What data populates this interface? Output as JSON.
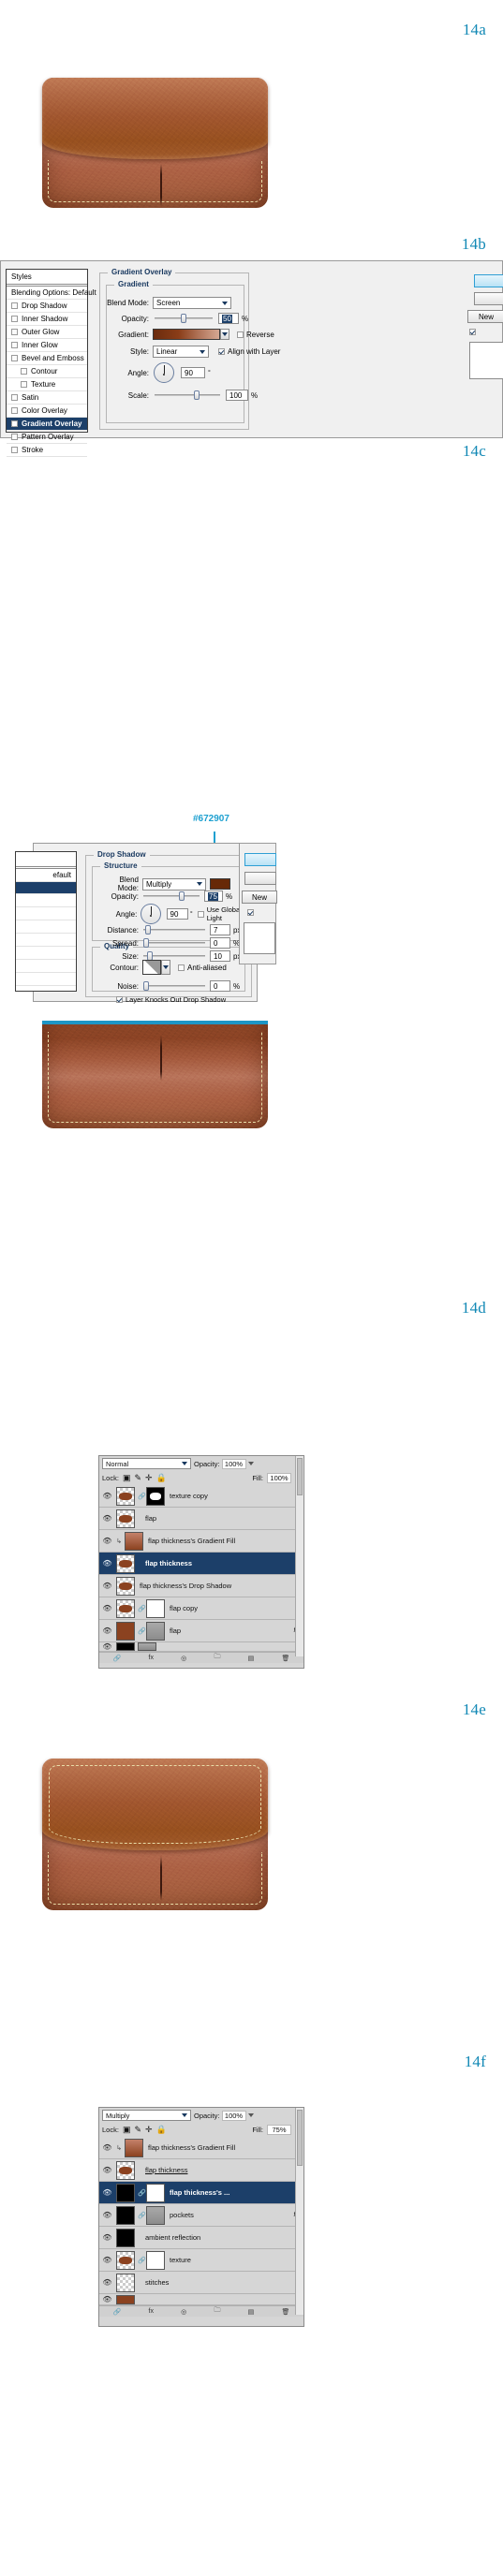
{
  "figures": [
    {
      "id": "14a",
      "label": "14a"
    },
    {
      "id": "14b",
      "label": "14b"
    },
    {
      "id": "14c",
      "label": "14c"
    },
    {
      "id": "14d",
      "label": "14d"
    },
    {
      "id": "14e",
      "label": "14e"
    },
    {
      "id": "14f",
      "label": "14f"
    }
  ],
  "colors": {
    "figure_label": "#1188b5",
    "callout": "#1da0d0",
    "drop_shadow_color": "#672907",
    "selection": "#1c3f69"
  },
  "gradient_overlay_dialog": {
    "styles_panel": {
      "header": "Styles",
      "blending_options": "Blending Options: Default",
      "items": [
        {
          "label": "Drop Shadow",
          "checked": false,
          "indent": false,
          "selected": false
        },
        {
          "label": "Inner Shadow",
          "checked": false,
          "indent": false,
          "selected": false
        },
        {
          "label": "Outer Glow",
          "checked": false,
          "indent": false,
          "selected": false
        },
        {
          "label": "Inner Glow",
          "checked": false,
          "indent": false,
          "selected": false
        },
        {
          "label": "Bevel and Emboss",
          "checked": false,
          "indent": false,
          "selected": false
        },
        {
          "label": "Contour",
          "checked": false,
          "indent": true,
          "selected": false
        },
        {
          "label": "Texture",
          "checked": false,
          "indent": true,
          "selected": false
        },
        {
          "label": "Satin",
          "checked": false,
          "indent": false,
          "selected": false
        },
        {
          "label": "Color Overlay",
          "checked": false,
          "indent": false,
          "selected": false
        },
        {
          "label": "Gradient Overlay",
          "checked": true,
          "indent": false,
          "selected": true
        },
        {
          "label": "Pattern Overlay",
          "checked": false,
          "indent": false,
          "selected": false
        },
        {
          "label": "Stroke",
          "checked": false,
          "indent": false,
          "selected": false
        }
      ]
    },
    "section_title": "Gradient Overlay",
    "group_title": "Gradient",
    "fields": {
      "blend_mode_label": "Blend Mode:",
      "blend_mode_value": "Screen",
      "opacity_label": "Opacity:",
      "opacity_value": "50",
      "opacity_unit": "%",
      "gradient_label": "Gradient:",
      "reverse_label": "Reverse",
      "reverse_checked": false,
      "style_label": "Style:",
      "style_value": "Linear",
      "align_label": "Align with Layer",
      "align_checked": true,
      "angle_label": "Angle:",
      "angle_value": "90",
      "angle_unit": "°",
      "scale_label": "Scale:",
      "scale_value": "100",
      "scale_unit": "%"
    },
    "buttons": {
      "new_style": "New"
    }
  },
  "drop_shadow_dialog": {
    "styles_panel": {
      "blending_options": "efault"
    },
    "callout_color": "#672907",
    "section_title": "Drop Shadow",
    "structure_title": "Structure",
    "quality_title": "Quality",
    "fields": {
      "blend_mode_label": "Blend Mode:",
      "blend_mode_value": "Multiply",
      "opacity_label": "Opacity:",
      "opacity_value": "75",
      "opacity_unit": "%",
      "angle_label": "Angle:",
      "angle_value": "90",
      "angle_unit": "°",
      "use_global_light": "Use Global Light",
      "use_global_checked": false,
      "distance_label": "Distance:",
      "distance_value": "7",
      "distance_unit": "px",
      "spread_label": "Spread:",
      "spread_value": "0",
      "spread_unit": "%",
      "size_label": "Size:",
      "size_value": "10",
      "size_unit": "px",
      "contour_label": "Contour:",
      "anti_aliased_label": "Anti-aliased",
      "anti_aliased_checked": false,
      "noise_label": "Noise:",
      "noise_value": "0",
      "noise_unit": "%",
      "knockout_label": "Layer Knocks Out Drop Shadow",
      "knockout_checked": true
    },
    "buttons": {
      "new_style": "New"
    }
  },
  "layers_panel_d": {
    "blend_mode": "Normal",
    "opacity_label": "Opacity:",
    "opacity_value": "100%",
    "lock_label": "Lock:",
    "fill_label": "Fill:",
    "fill_value": "100%",
    "layers": [
      {
        "name": "texture copy",
        "thumb": "transparent",
        "has_mask": true,
        "mask": "black",
        "linked": true,
        "selected": false,
        "fx": ""
      },
      {
        "name": "flap",
        "thumb": "transparent",
        "has_mask": false,
        "selected": false,
        "fx": ""
      },
      {
        "name": "flap thickness's Gradient Fill",
        "thumb": "gradient",
        "has_mask": false,
        "clipped": true,
        "selected": false,
        "fx": ""
      },
      {
        "name": "flap thickness",
        "thumb": "transparent",
        "has_mask": false,
        "selected": true,
        "fx": ""
      },
      {
        "name": "flap thickness's Drop Shadow",
        "thumb": "transparent",
        "has_mask": false,
        "clipped": true,
        "selected": false,
        "fx": ""
      },
      {
        "name": "flap copy",
        "thumb": "solid",
        "has_mask": true,
        "mask": "white",
        "selected": false,
        "fx": ""
      },
      {
        "name": "flap",
        "thumb": "solid",
        "has_mask": true,
        "mask": "grey",
        "selected": false,
        "fx": "fx"
      }
    ]
  },
  "layers_panel_f": {
    "blend_mode": "Multiply",
    "opacity_label": "Opacity:",
    "opacity_value": "100%",
    "lock_label": "Lock:",
    "fill_label": "Fill:",
    "fill_value": "75%",
    "layers": [
      {
        "name": "flap thickness's Gradient Fill",
        "thumb": "gradient",
        "has_mask": false,
        "clipped": true,
        "selected": false,
        "fx": ""
      },
      {
        "name": "flap thickness",
        "thumb": "transparent",
        "has_mask": false,
        "selected": false,
        "underline": true,
        "fx": ""
      },
      {
        "name": "flap thickness's ...",
        "thumb": "black",
        "has_mask": true,
        "mask": "white",
        "selected": true,
        "fx": ""
      },
      {
        "name": "pockets",
        "thumb": "grey",
        "has_mask": true,
        "mask": "grey",
        "selected": false,
        "fx": "fx"
      },
      {
        "name": "ambient reflection",
        "thumb": "black",
        "has_mask": false,
        "selected": false,
        "fx": ""
      },
      {
        "name": "texture",
        "thumb": "transparent",
        "has_mask": true,
        "mask": "white",
        "selected": false,
        "fx": ""
      },
      {
        "name": "stitches",
        "thumb": "transparent",
        "has_mask": false,
        "selected": false,
        "fx": ""
      }
    ]
  }
}
